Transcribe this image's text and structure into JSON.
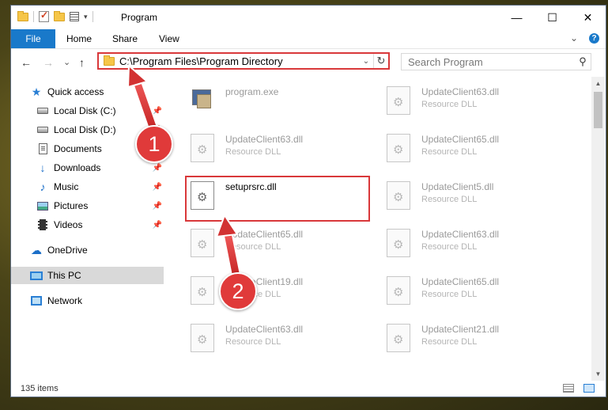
{
  "window": {
    "title": "Program",
    "controls": {
      "minimize": "—",
      "maximize": "☐",
      "close": "✕"
    },
    "qat_dropdown": "▾"
  },
  "ribbon": {
    "tabs": [
      "File",
      "Home",
      "Share",
      "View"
    ],
    "expand_glyph": "⌄",
    "help_glyph": "?"
  },
  "navigation": {
    "back": "←",
    "forward": "→",
    "recent": "⌄",
    "up": "↑",
    "address": "C:\\Program Files\\Program Directory",
    "address_dropdown": "⌄",
    "refresh": "↻",
    "search_placeholder": "Search Program",
    "search_glyph": "⚲"
  },
  "sidebar": {
    "items": [
      {
        "label": "Quick access",
        "icon": "star-icon",
        "pinned": false
      },
      {
        "label": "Local Disk (C:)",
        "icon": "disk-icon",
        "pinned": true
      },
      {
        "label": "Local Disk (D:)",
        "icon": "disk-icon",
        "pinned": true
      },
      {
        "label": "Documents",
        "icon": "documents-icon",
        "pinned": true
      },
      {
        "label": "Downloads",
        "icon": "downloads-icon",
        "pinned": true
      },
      {
        "label": "Music",
        "icon": "music-icon",
        "pinned": true
      },
      {
        "label": "Pictures",
        "icon": "pictures-icon",
        "pinned": true
      },
      {
        "label": "Videos",
        "icon": "videos-icon",
        "pinned": true
      },
      {
        "label": "OneDrive",
        "icon": "onedrive-icon",
        "pinned": false
      },
      {
        "label": "This PC",
        "icon": "this-pc-icon",
        "pinned": false,
        "selected": true
      },
      {
        "label": "Network",
        "icon": "network-icon",
        "pinned": false
      }
    ],
    "pin_glyph": "📌"
  },
  "files": {
    "left_column": [
      {
        "name": "program.exe",
        "type": ""
      },
      {
        "name": "UpdateClient63.dll",
        "type": "Resource DLL"
      },
      {
        "name": "setuprsrc.dll",
        "type": ""
      },
      {
        "name": "UpdateClient65.dll",
        "type": "Resource DLL"
      },
      {
        "name": "UpdateClient19.dll",
        "type": "Resource DLL"
      },
      {
        "name": "UpdateClient63.dll",
        "type": "Resource DLL"
      }
    ],
    "right_column": [
      {
        "name": "UpdateClient63.dll",
        "type": "Resource DLL"
      },
      {
        "name": "UpdateClient65.dll",
        "type": "Resource DLL"
      },
      {
        "name": "UpdateClient5.dll",
        "type": "Resource DLL"
      },
      {
        "name": "UpdateClient63.dll",
        "type": "Resource DLL"
      },
      {
        "name": "UpdateClient65.dll",
        "type": "Resource DLL"
      },
      {
        "name": "UpdateClient21.dll",
        "type": "Resource DLL"
      }
    ]
  },
  "status": {
    "item_count": "135 items"
  },
  "scrollbar": {
    "up": "▲",
    "down": "▼"
  },
  "annotations": {
    "callout_1": "1",
    "callout_2": "2",
    "accent": "#e03a3a"
  }
}
